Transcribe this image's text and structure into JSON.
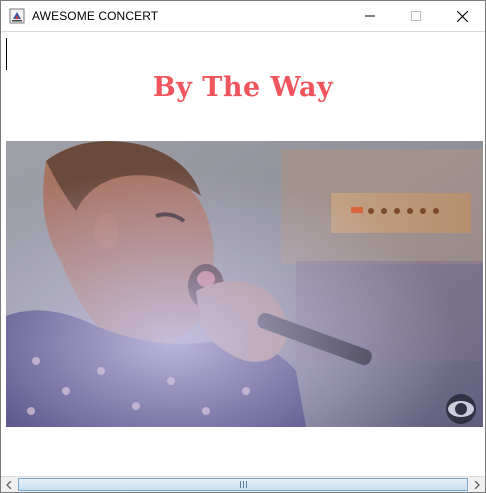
{
  "window": {
    "title": "AWESOME CONCERT",
    "app_icon": "java-cup-icon",
    "controls": [
      "minimize-icon",
      "maximize-icon",
      "close-icon"
    ]
  },
  "main": {
    "song_title": "By The Way",
    "song_title_color": "#f0545c",
    "video": {
      "description_icon": "concert-video-frame",
      "watermark_icon": "cbs-eye-icon"
    }
  },
  "scrollbar": {
    "orientation": "horizontal"
  }
}
